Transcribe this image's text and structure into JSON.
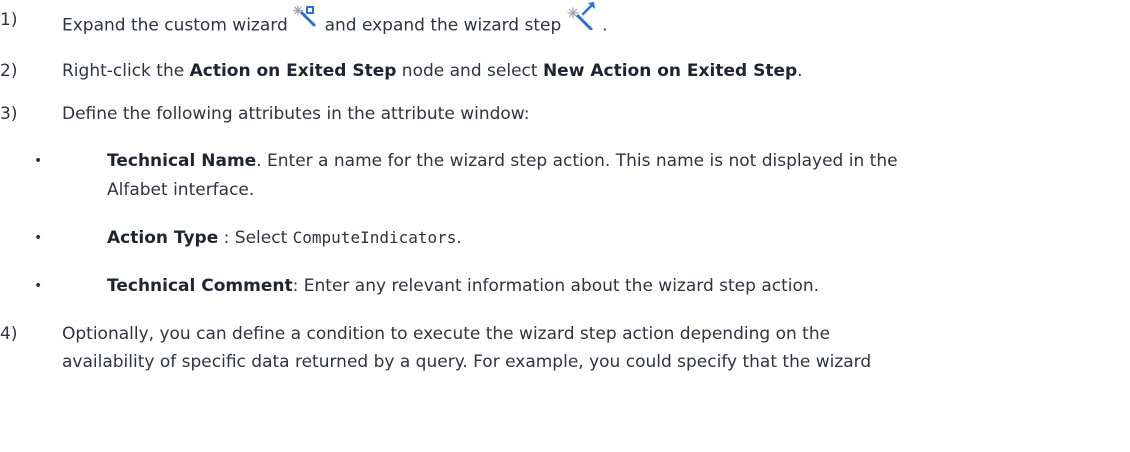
{
  "steps": {
    "s1": {
      "num": "1)",
      "text_a": "Expand the custom wizard",
      "text_b": "and expand the wizard step",
      "text_c": "."
    },
    "s2": {
      "num": "2)",
      "pre": "Right-click the ",
      "node": "Action on Exited Step",
      "mid": " node and select ",
      "command": "New Action on Exited Step",
      "post": "."
    },
    "s3": {
      "num": "3)",
      "text": "Define the following attributes in the attribute window:"
    },
    "s4": {
      "num": "4)",
      "line1": "Optionally, you can define a condition to execute the wizard step action depending on the",
      "line2": "availability of specific data returned by a query. For example, you could specify that the wizard"
    }
  },
  "attributes": [
    {
      "bullet": "•",
      "name": "Technical Name",
      "sep": ".",
      "line1": " Enter a name for the wizard step action. This name is not displayed in the",
      "line2": "Alfabet interface."
    },
    {
      "bullet": "•",
      "name": "Action Type",
      "sep": " : Select ",
      "value": "ComputeIndicators",
      "post": "."
    },
    {
      "bullet": "•",
      "name": "Technical Comment",
      "sep": ":",
      "line1": " Enter any relevant information about the wizard step action."
    }
  ],
  "icons": {
    "custom_wizard": "custom-wizard-icon",
    "wizard_step": "wizard-step-icon",
    "accent_blue": "#2a6fd6"
  }
}
